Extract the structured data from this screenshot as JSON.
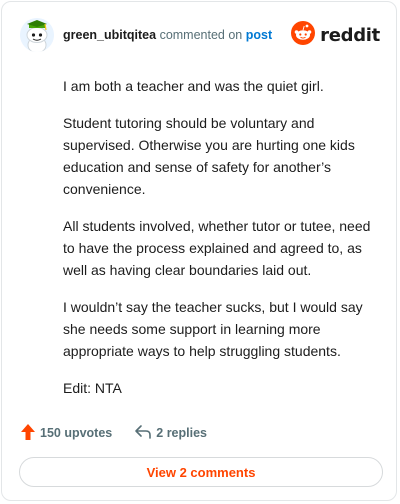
{
  "header": {
    "username": "green_ubitqitea",
    "action_text": "commented on",
    "post_link": "post",
    "brand": "reddit"
  },
  "comment": {
    "paragraphs": [
      "I am both a teacher and was the quiet girl.",
      "Student tutoring should be voluntary and supervised. Otherwise you are hurting one kids education and sense of safety for another’s convenience.",
      "All students involved, whether tutor or tutee, need to have the process explained and agreed to, as well as having clear boundaries laid out.",
      "I wouldn’t say the teacher sucks, but I would say she needs some support in learning more appropriate ways to help struggling students.",
      "Edit: NTA"
    ]
  },
  "footer": {
    "upvotes_label": "150 upvotes",
    "replies_label": "2 replies",
    "view_comments_label": "View 2 comments"
  },
  "colors": {
    "brand_orange": "#ff4500",
    "link_blue": "#0079d3",
    "muted_text": "#576f76"
  },
  "icons": {
    "avatar": "snoo-avatar-icon",
    "logo": "reddit-logo-icon",
    "upvote": "upvote-arrow-icon",
    "reply": "reply-arrow-icon"
  }
}
